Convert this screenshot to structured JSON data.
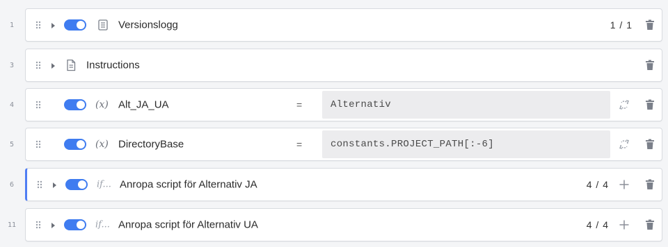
{
  "colors": {
    "accent": "#3f7cf0",
    "active_border": "#4f7df3"
  },
  "rows": [
    {
      "line": "1",
      "expand": true,
      "toggle": true,
      "icon": "log-icon",
      "title": "Versionslogg",
      "count": "1 / 1"
    },
    {
      "line": "3",
      "expand": true,
      "toggle": false,
      "icon": "document-icon",
      "title": "Instructions"
    },
    {
      "line": "4",
      "toggle": true,
      "icon": "variable-icon",
      "icon_text": "(x)",
      "title": "Alt_JA_UA",
      "operator": "=",
      "value": "Alternativ"
    },
    {
      "line": "5",
      "toggle": true,
      "icon": "variable-icon",
      "icon_text": "(x)",
      "title": "DirectoryBase",
      "operator": "=",
      "value": "constants.PROJECT_PATH[:-6]"
    },
    {
      "line": "6",
      "expand": true,
      "toggle": true,
      "icon": "condition-icon",
      "icon_text": "if...",
      "title": "Anropa script för Alternativ JA",
      "count": "4 / 4",
      "active": true
    },
    {
      "line": "11",
      "expand": true,
      "toggle": true,
      "icon": "condition-icon",
      "icon_text": "if...",
      "title": "Anropa script för Alternativ UA",
      "count": "4 / 4"
    }
  ]
}
